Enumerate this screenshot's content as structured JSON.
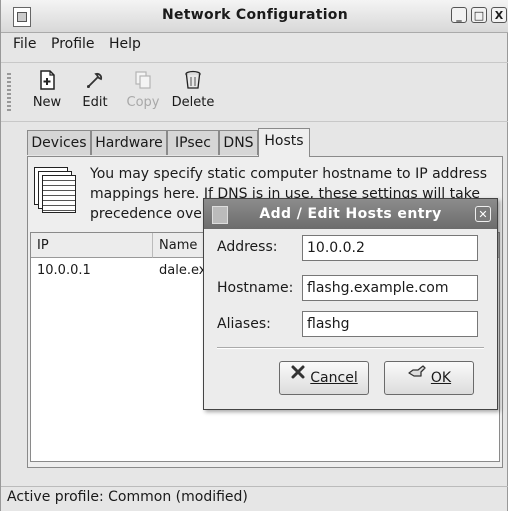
{
  "window": {
    "title": "Network Configuration",
    "controls": {
      "minimize": "_",
      "maximize": "□",
      "close": "X"
    }
  },
  "menu": [
    "File",
    "Profile",
    "Help"
  ],
  "toolbar": {
    "new_label": "New",
    "edit_label": "Edit",
    "copy_label": "Copy",
    "delete_label": "Delete",
    "copy_disabled": true
  },
  "tabs": [
    "Devices",
    "Hardware",
    "IPsec",
    "DNS",
    "Hosts"
  ],
  "active_tab": "Hosts",
  "hosts": {
    "description_lines": [
      "You may specify static computer hostname to IP address",
      "mappings here.  If DNS is in use, these settings will take",
      "precedence over"
    ],
    "columns": [
      "IP",
      "Name"
    ],
    "rows": [
      {
        "ip": "10.0.0.1",
        "name": "dale.ex"
      }
    ]
  },
  "dialog": {
    "title": "Add / Edit Hosts entry",
    "address_label": "Address:",
    "address_value": "10.0.0.2",
    "hostname_label": "Hostname:",
    "hostname_value": "flashg.example.com",
    "aliases_label": "Aliases:",
    "aliases_value": "flashg",
    "cancel_label": "Cancel",
    "ok_label": "OK"
  },
  "status": "Active profile: Common (modified)",
  "colors": {
    "window_bg": "#e6e6e6",
    "dialog_title_bg": "#7c7c7c",
    "field_bg": "#ffffff"
  },
  "icons": [
    "app-icon",
    "new-icon",
    "edit-icon",
    "copy-icon",
    "delete-icon",
    "hosts-file-icon",
    "cancel-icon",
    "ok-icon",
    "close-icon"
  ]
}
